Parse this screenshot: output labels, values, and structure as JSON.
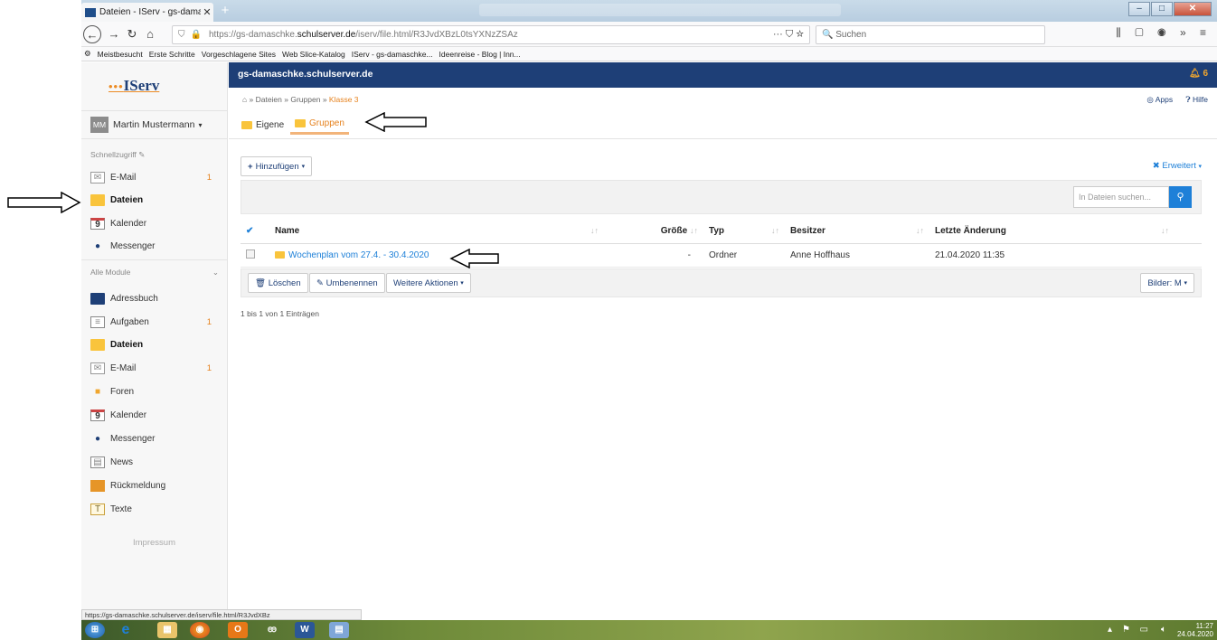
{
  "browser": {
    "tab_title": "Dateien - IServ - gs-damaschke",
    "new_tab": "+",
    "url_prefix": "https://gs-damaschke.",
    "url_domain": "schulserver.de",
    "url_path": "/iserv/file.html/R3JvdXBzL0tsYXNzZSAz",
    "page_actions": "··· ⛉ ☆",
    "search_placeholder": "Suchen",
    "bookmarks": [
      "Meistbesucht",
      "Erste Schritte",
      "Vorgeschlagene Sites",
      "Web Slice-Katalog",
      "IServ - gs-damaschke...",
      "Ideenreise - Blog | Inn..."
    ],
    "status_url": "https://gs-damaschke.schulserver.de/iserv/file.html/R3JvdXBz"
  },
  "sidebar": {
    "logo": "IServ",
    "user_name": "Martin Mustermann",
    "user_initials": "MM",
    "quick_title": "Schnellzugriff",
    "quick_items": [
      {
        "label": "E-Mail",
        "count": "1"
      },
      {
        "label": "Dateien",
        "count": ""
      },
      {
        "label": "Kalender",
        "count": ""
      },
      {
        "label": "Messenger",
        "count": ""
      }
    ],
    "modules_title": "Alle Module",
    "modules": [
      {
        "label": "Adressbuch",
        "count": ""
      },
      {
        "label": "Aufgaben",
        "count": "1"
      },
      {
        "label": "Dateien",
        "count": ""
      },
      {
        "label": "E-Mail",
        "count": "1"
      },
      {
        "label": "Foren",
        "count": ""
      },
      {
        "label": "Kalender",
        "count": ""
      },
      {
        "label": "Messenger",
        "count": ""
      },
      {
        "label": "News",
        "count": ""
      },
      {
        "label": "Rückmeldung",
        "count": ""
      },
      {
        "label": "Texte",
        "count": ""
      }
    ],
    "calendar_day": "9",
    "impressum": "Impressum"
  },
  "header": {
    "site": "gs-damaschke.schulserver.de",
    "notifications": "6",
    "apps": "Apps",
    "help": "Hilfe"
  },
  "breadcrumb": {
    "items": [
      "Dateien",
      "Gruppen"
    ],
    "current": "Klasse 3"
  },
  "tabs": [
    "Eigene",
    "Gruppen"
  ],
  "toolbar": {
    "add": "Hinzufügen",
    "advanced": "Erweitert",
    "search_placeholder": "In Dateien suchen..."
  },
  "table": {
    "headers": [
      "Name",
      "Größe",
      "Typ",
      "Besitzer",
      "Letzte Änderung"
    ],
    "rows": [
      {
        "name": "Wochenplan vom 27.4. - 30.4.2020",
        "size": "-",
        "type": "Ordner",
        "owner": "Anne Hoffhaus",
        "modified": "21.04.2020 11:35"
      }
    ]
  },
  "actions": {
    "delete": "Löschen",
    "rename": "Umbenennen",
    "more": "Weitere Aktionen",
    "images": "Bilder: M"
  },
  "count_info": "1 bis 1 von 1 Einträgen",
  "taskbar": {
    "time": "11:27",
    "date": "24.04.2020"
  }
}
